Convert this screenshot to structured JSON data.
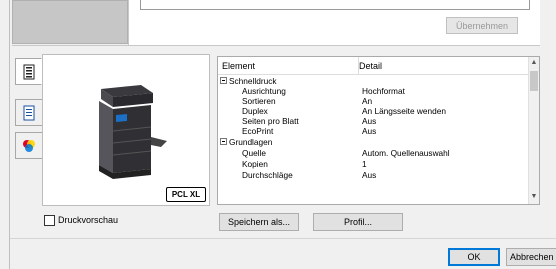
{
  "top": {
    "apply_label": "Übernehmen"
  },
  "tabs": [
    {
      "icon": "printer-settings-icon"
    },
    {
      "icon": "document-icon"
    },
    {
      "icon": "color-icon"
    }
  ],
  "preview": {
    "badge": "PCL XL"
  },
  "table": {
    "headers": {
      "element": "Element",
      "detail": "Detail"
    },
    "rows": [
      {
        "type": "group",
        "label": "Schnelldruck"
      },
      {
        "type": "item",
        "label": "Ausrichtung",
        "value": "Hochformat"
      },
      {
        "type": "item",
        "label": "Sortieren",
        "value": "An"
      },
      {
        "type": "item",
        "label": "Duplex",
        "value": "An Längsseite wenden"
      },
      {
        "type": "item",
        "label": "Seiten pro Blatt",
        "value": "Aus"
      },
      {
        "type": "item",
        "label": "EcoPrint",
        "value": "Aus"
      },
      {
        "type": "group",
        "label": "Grundlagen"
      },
      {
        "type": "item",
        "label": "Quelle",
        "value": "Autom. Quellenauswahl"
      },
      {
        "type": "item",
        "label": "Kopien",
        "value": "1"
      },
      {
        "type": "item",
        "label": "Durchschläge",
        "value": "Aus"
      }
    ]
  },
  "bottom": {
    "preview_checkbox_label": "Druckvorschau",
    "save_as_label": "Speichern als...",
    "profile_label": "Profil...",
    "ok_label": "OK",
    "cancel_label": "Abbrechen"
  }
}
